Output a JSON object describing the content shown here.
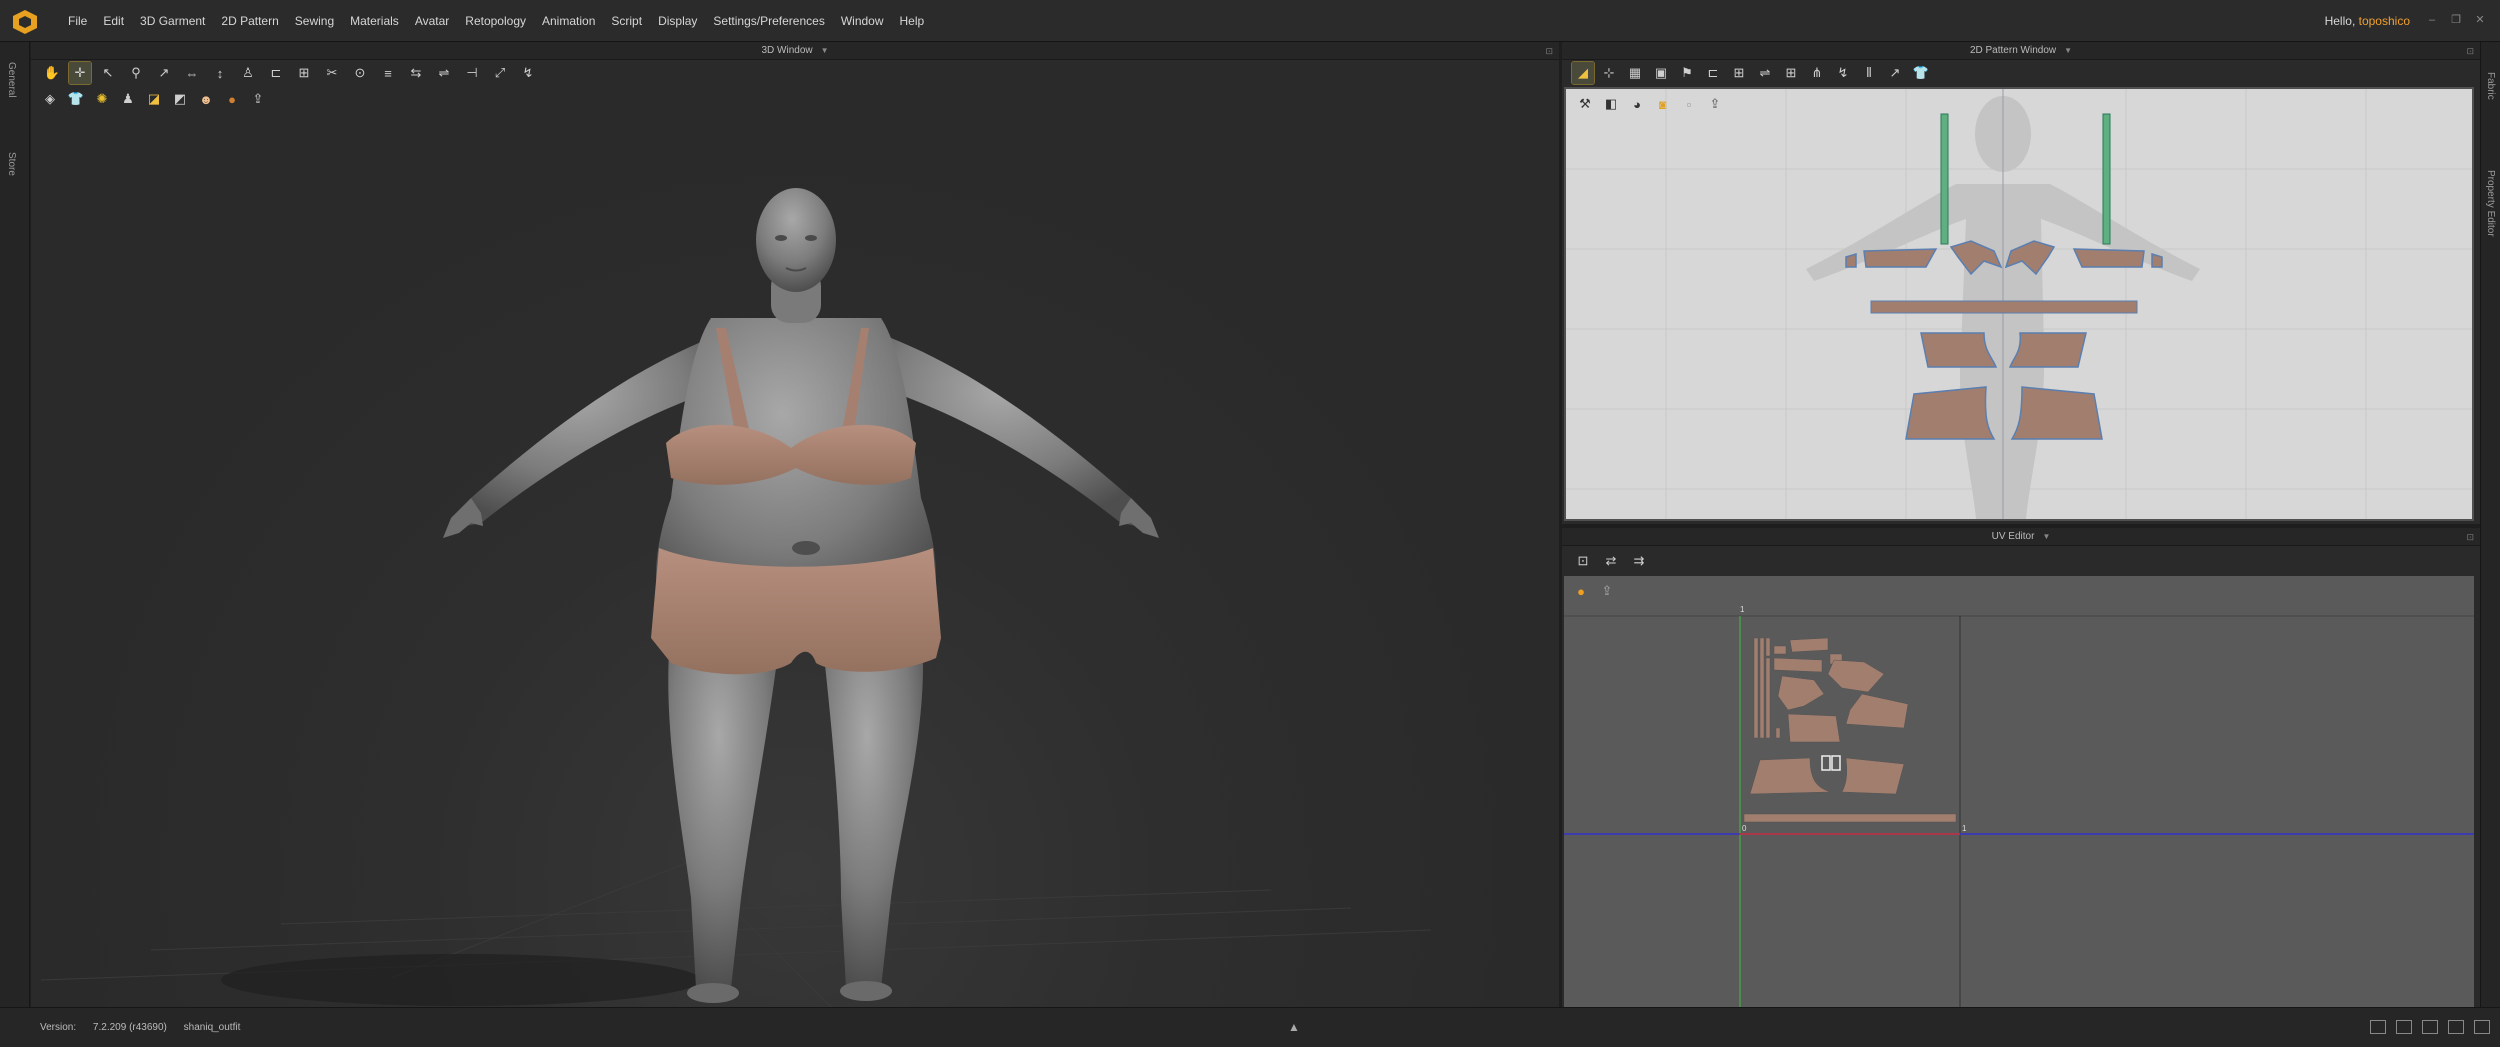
{
  "menubar": {
    "items": [
      "File",
      "Edit",
      "3D Garment",
      "2D Pattern",
      "Sewing",
      "Materials",
      "Avatar",
      "Retopology",
      "Animation",
      "Script",
      "Display",
      "Settings/Preferences",
      "Window",
      "Help"
    ],
    "greeting": "Hello,",
    "username": "toposhico"
  },
  "side_tabs": {
    "general": "General",
    "store": "Store"
  },
  "right_tabs": {
    "fabric": "Fabric",
    "property_editor": "Property Editor"
  },
  "win3d": {
    "title": "3D Window"
  },
  "win2d": {
    "title": "2D Pattern Window"
  },
  "winuv": {
    "title": "UV Editor",
    "axis_labels": {
      "top_one": "1",
      "origin": "0",
      "right_one": "1"
    }
  },
  "status": {
    "version_label": "Version:",
    "version_value": "7.2.209 (r43690)",
    "file": "shaniq_outfit"
  },
  "colors": {
    "accent": "#f0a030",
    "garment": "#a27e6f",
    "body": "#7c7c7c",
    "uv_bg": "#5a5a5a",
    "pattern_bg": "#d7d7d7"
  },
  "icons": [
    "app-logo-icon",
    "select-icon",
    "transform-icon",
    "avatar-icon",
    "fabric-icon"
  ]
}
